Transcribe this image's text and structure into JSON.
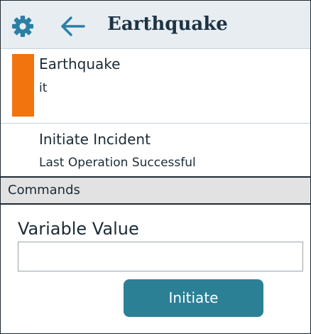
{
  "header": {
    "title": "Earthquake",
    "settings_icon": "gear-icon",
    "back_icon": "arrow-left-icon"
  },
  "incident": {
    "title": "Earthquake",
    "subtitle": "it",
    "status_color": "#f2740f"
  },
  "operation": {
    "title": "Initiate Incident",
    "status": "Last Operation Successful"
  },
  "commands": {
    "section_label": "Commands",
    "field_label": "Variable Value",
    "field_value": "",
    "field_placeholder": "",
    "button_label": "Initiate"
  },
  "colors": {
    "accent": "#2b8096",
    "header_bg": "#e8edf2",
    "icon": "#2b7fa5",
    "section_bg": "#e2e2e2"
  }
}
